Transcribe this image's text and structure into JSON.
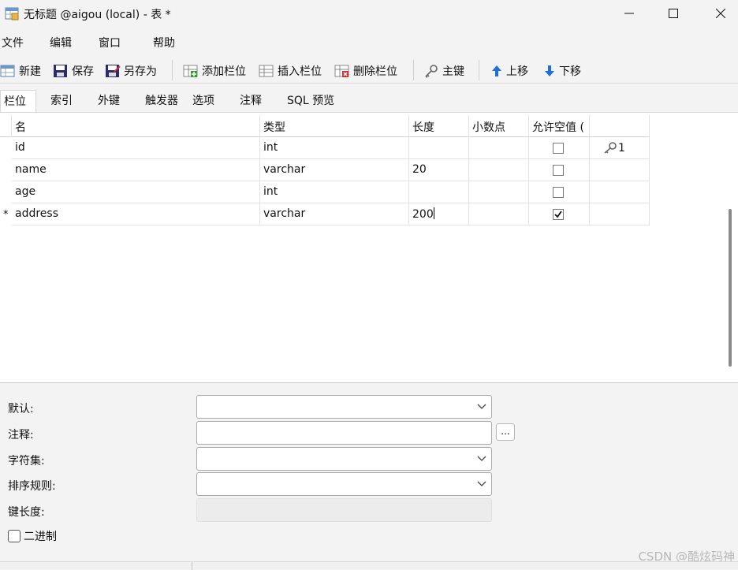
{
  "window": {
    "title": "无标题 @aigou (local) - 表 *"
  },
  "menu": [
    "文件",
    "编辑",
    "窗口",
    "帮助"
  ],
  "toolbar": {
    "new": "新建",
    "save": "保存",
    "save_as": "另存为",
    "add_column": "添加栏位",
    "insert_column": "插入栏位",
    "delete_column": "删除栏位",
    "primary_key": "主键",
    "move_up": "上移",
    "move_down": "下移"
  },
  "tabs": [
    "栏位",
    "索引",
    "外键",
    "触发器",
    "选项",
    "注释",
    "SQL 预览"
  ],
  "grid": {
    "headers": [
      "名",
      "类型",
      "长度",
      "小数点",
      "允许空值 ("
    ],
    "rows": [
      {
        "marker": "",
        "name": "id",
        "type": "int",
        "length": "",
        "decimals": "",
        "nullable": false,
        "key": "1"
      },
      {
        "marker": "",
        "name": "name",
        "type": "varchar",
        "length": "20",
        "decimals": "",
        "nullable": false,
        "key": ""
      },
      {
        "marker": "",
        "name": "age",
        "type": "int",
        "length": "",
        "decimals": "",
        "nullable": false,
        "key": ""
      },
      {
        "marker": "*",
        "name": "address",
        "type": "varchar",
        "length": "200",
        "decimals": "",
        "nullable": true,
        "key": ""
      }
    ]
  },
  "props": {
    "default_label": "默认:",
    "comment_label": "注释:",
    "charset_label": "字符集:",
    "collation_label": "排序规则:",
    "key_length_label": "键长度:",
    "binary_label": "二进制",
    "ellipsis": "..."
  },
  "watermark": "CSDN @酷炫码神",
  "colors": {
    "accent": "#1e6fd9",
    "save_icon": "#2b2b6b"
  }
}
